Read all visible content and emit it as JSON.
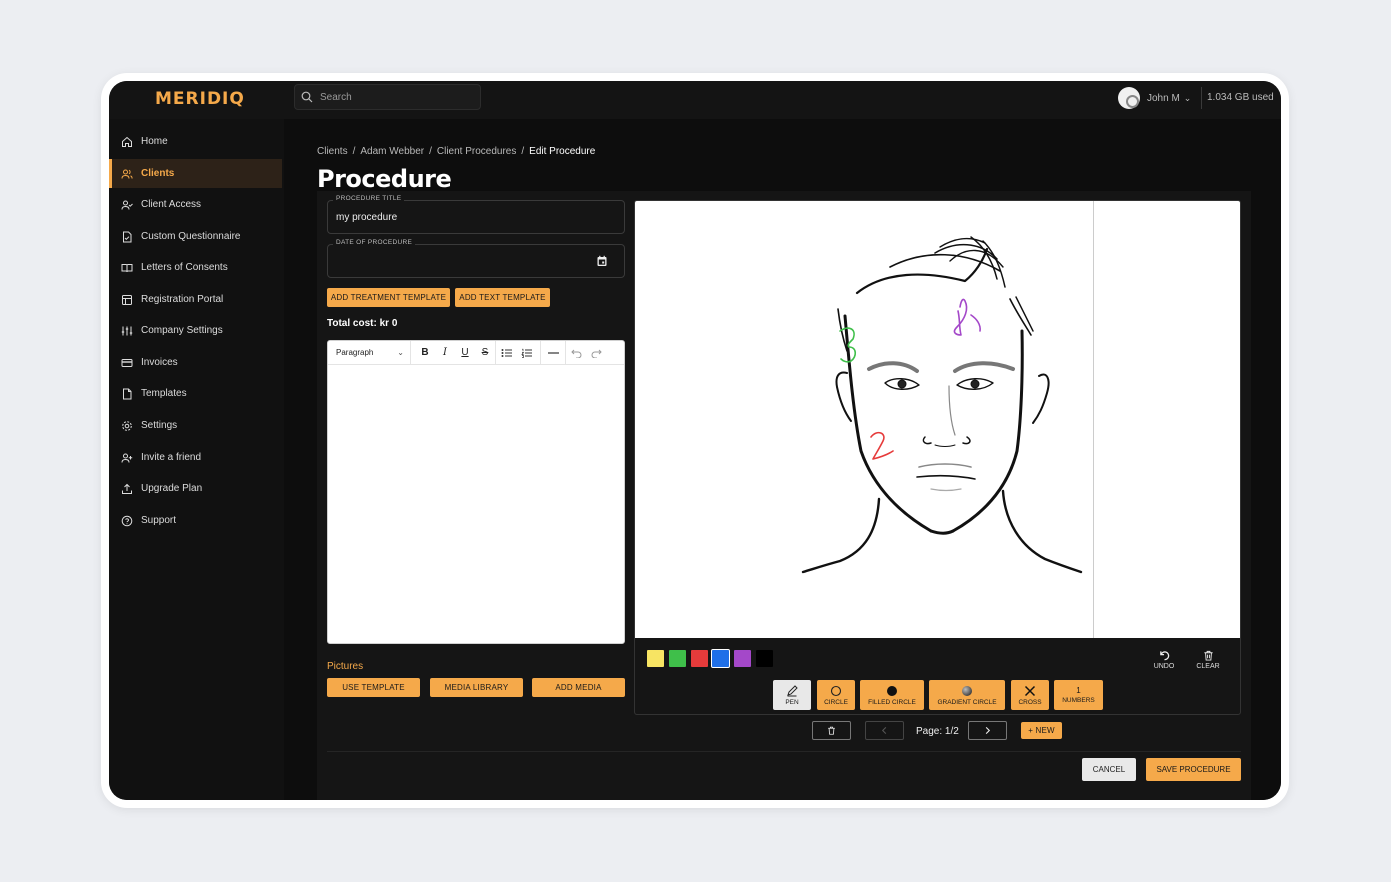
{
  "app": {
    "logo": "MERIDIQ"
  },
  "topbar": {
    "search_placeholder": "Search",
    "user_name": "John M",
    "storage_used": "1.034 GB used"
  },
  "sidebar": {
    "items": [
      {
        "label": "Home",
        "icon": "home-icon"
      },
      {
        "label": "Clients",
        "icon": "users-icon",
        "active": true
      },
      {
        "label": "Client Access",
        "icon": "user-check-icon"
      },
      {
        "label": "Custom Questionnaire",
        "icon": "file-check-icon"
      },
      {
        "label": "Letters of Consents",
        "icon": "book-icon"
      },
      {
        "label": "Registration Portal",
        "icon": "layout-icon"
      },
      {
        "label": "Company Settings",
        "icon": "sliders-icon"
      },
      {
        "label": "Invoices",
        "icon": "credit-card-icon"
      },
      {
        "label": "Templates",
        "icon": "file-icon"
      },
      {
        "label": "Settings",
        "icon": "gear-icon"
      },
      {
        "label": "Invite a friend",
        "icon": "user-plus-icon"
      },
      {
        "label": "Upgrade Plan",
        "icon": "upload-icon"
      },
      {
        "label": "Support",
        "icon": "help-circle-icon"
      }
    ]
  },
  "breadcrumb": {
    "items": [
      "Clients",
      "Adam Webber",
      "Client Procedures"
    ],
    "separator": "/",
    "current": "Edit Procedure"
  },
  "page": {
    "title": "Procedure"
  },
  "form": {
    "procedure_title_label": "PROCEDURE TITLE",
    "procedure_title_value": "my procedure",
    "date_label": "DATE OF PROCEDURE",
    "date_value": "",
    "add_treatment_template": "ADD TREATMENT TEMPLATE",
    "add_text_template": "ADD TEXT TEMPLATE",
    "total_cost": "Total cost: kr 0"
  },
  "editor": {
    "block_format": "Paragraph",
    "tools": [
      "bold",
      "italic",
      "underline",
      "strikethrough",
      "bullet-list",
      "numbered-list",
      "horizontal-rule",
      "undo",
      "redo"
    ]
  },
  "pictures": {
    "heading": "Pictures",
    "use_template": "USE TEMPLATE",
    "media_library": "MEDIA LIBRARY",
    "add_media": "ADD MEDIA"
  },
  "drawing": {
    "colors": [
      "#f7e463",
      "#3fbf4a",
      "#e63b3b",
      "#1e6fe8",
      "#a448c9",
      "#000000"
    ],
    "selected_color": "#1e6fe8",
    "annotations": [
      "1",
      "2",
      "3"
    ],
    "undo": "UNDO",
    "clear": "CLEAR",
    "tools": {
      "pen": "PEN",
      "circle": "CIRCLE",
      "filled_circle": "FILLED CIRCLE",
      "gradient_circle": "GRADIENT CIRCLE",
      "cross": "CROSS",
      "numbers_value": "1",
      "numbers": "NUMBERS"
    },
    "active_tool": "PEN",
    "page_text": "Page: 1/2",
    "new_page": "+ NEW"
  },
  "actions": {
    "cancel": "CANCEL",
    "save": "SAVE PROCEDURE"
  }
}
